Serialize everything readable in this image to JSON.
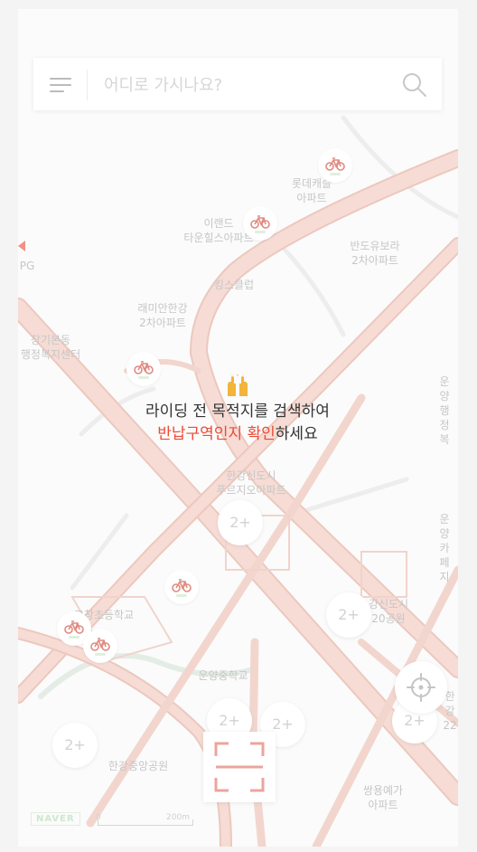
{
  "search": {
    "placeholder": "어디로 가시나요?",
    "menu_icon": "menu-icon",
    "search_icon": "search-icon"
  },
  "hint": {
    "icon": "hands-raised-emoji",
    "line1": "라이딩 전 목적지를 검색하여",
    "highlight": "반납구역인지 확인",
    "suffix": "하세요",
    "highlight_color": "#ee4a35"
  },
  "map": {
    "labels": [
      {
        "text": "롯데캐슬\n아파트"
      },
      {
        "text": "이랜드\n타운힐스아파트"
      },
      {
        "text": "반도유보라\n2차아파트"
      },
      {
        "text": "PG"
      },
      {
        "text": "킹스클럽"
      },
      {
        "text": "래미안한강\n2차아파트"
      },
      {
        "text": "장기본동\n행정복지센터"
      },
      {
        "text": "운양\n행정복"
      },
      {
        "text": "한강신도시\n푸르지오아파트"
      },
      {
        "text": "운양\n카페지"
      },
      {
        "text": "강신도시\n20공원"
      },
      {
        "text": "고창초등학교"
      },
      {
        "text": "운양중학교"
      },
      {
        "text": "한강중앙공원"
      },
      {
        "text": "한강\n22"
      },
      {
        "text": "쌍용예가\n아파트"
      }
    ],
    "clusters": [
      "2+",
      "2+",
      "2+",
      "2+",
      "2+",
      "2+"
    ],
    "bike_icon": "bicycle-icon"
  },
  "controls": {
    "locate_icon": "current-location-icon",
    "scan_icon": "qr-scan-icon"
  },
  "footer": {
    "logo": "NAVER",
    "scale_start": "0",
    "scale_end": "200m"
  },
  "colors": {
    "road": "#f5dad3",
    "road_edge": "#ecc8be",
    "accent": "#ee4a35",
    "bike": "#e08a80"
  }
}
